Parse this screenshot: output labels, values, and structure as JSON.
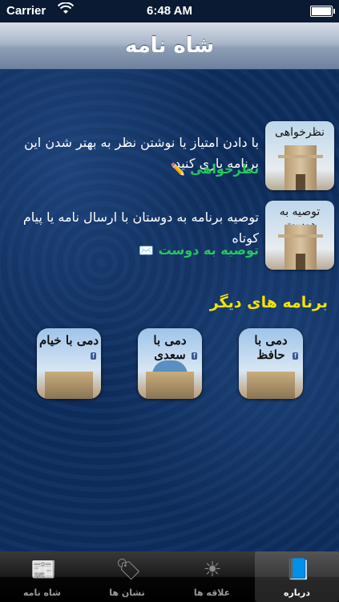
{
  "status_bar": {
    "carrier": "Carrier",
    "time": "6:48 AM",
    "wifi_icon": "wifi-icon",
    "battery_icon": "battery-icon",
    "battery_level_pct": 100
  },
  "nav": {
    "title": "شاه نامه"
  },
  "feedback": {
    "thumb_caption": "نظرخواهی",
    "description": "با دادن امتیاز یا نوشتن نظر به بهتر شدن این برنامه یاری کنید",
    "action_label": "نظرخواهی",
    "action_icon": "pencil-icon"
  },
  "recommend": {
    "thumb_caption": "توصیه به دوست",
    "description": "توصیه برنامه به دوستان با ارسال نامه یا پیام کوتاه",
    "action_label": "توصیه به دوست",
    "action_icon": "envelope-icon"
  },
  "other_apps": {
    "heading": "برنامه های دیگر",
    "apps": [
      {
        "name": "دمی با حافظ"
      },
      {
        "name": "دمی با سعدی"
      },
      {
        "name": "دمی با خیام"
      }
    ]
  },
  "tabs": [
    {
      "label": "درباره",
      "icon": "book-icon",
      "active": true
    },
    {
      "label": "علاقه ها",
      "icon": "sun-icon",
      "active": false
    },
    {
      "label": "نشان ها",
      "icon": "tag-icon",
      "active": false
    },
    {
      "label": "شاه نامه",
      "icon": "newspaper-icon",
      "active": false
    }
  ]
}
